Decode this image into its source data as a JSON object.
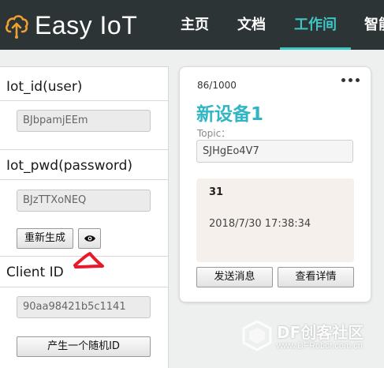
{
  "header": {
    "brand": "Easy IoT",
    "nav": [
      {
        "label": "主页",
        "active": false
      },
      {
        "label": "文档",
        "active": false
      },
      {
        "label": "工作间",
        "active": true
      },
      {
        "label": "智能",
        "active": false
      }
    ],
    "accent_color": "#3ec6c4",
    "logo_icon": "cloud-icon"
  },
  "left_panel": {
    "iot_id": {
      "title": "Iot_id(user)",
      "value": "BJbpamjEEm"
    },
    "iot_pwd": {
      "title": "Iot_pwd(password)",
      "value": "BJzTTXoNEQ"
    },
    "regenerate_label": "重新生成",
    "reveal_icon": "eye-icon",
    "client_id": {
      "title": "Client ID",
      "value": "90aa98421b5c1141"
    },
    "random_id_label": "产生一个随机ID"
  },
  "device_card": {
    "count": "86/1000",
    "name": "新设备1",
    "name_color": "#2fb5c4",
    "topic_label": "Topic：",
    "topic_value": "SJHgEo4V7",
    "last_message": {
      "value": "31",
      "time": "2018/7/30 17:38:34"
    },
    "send_label": "发送消息",
    "details_label": "查看详情",
    "menu_icon": "more-dots-icon"
  },
  "watermark": {
    "title": "DF创客社区",
    "url": "www.DFRobot.com.cn"
  }
}
